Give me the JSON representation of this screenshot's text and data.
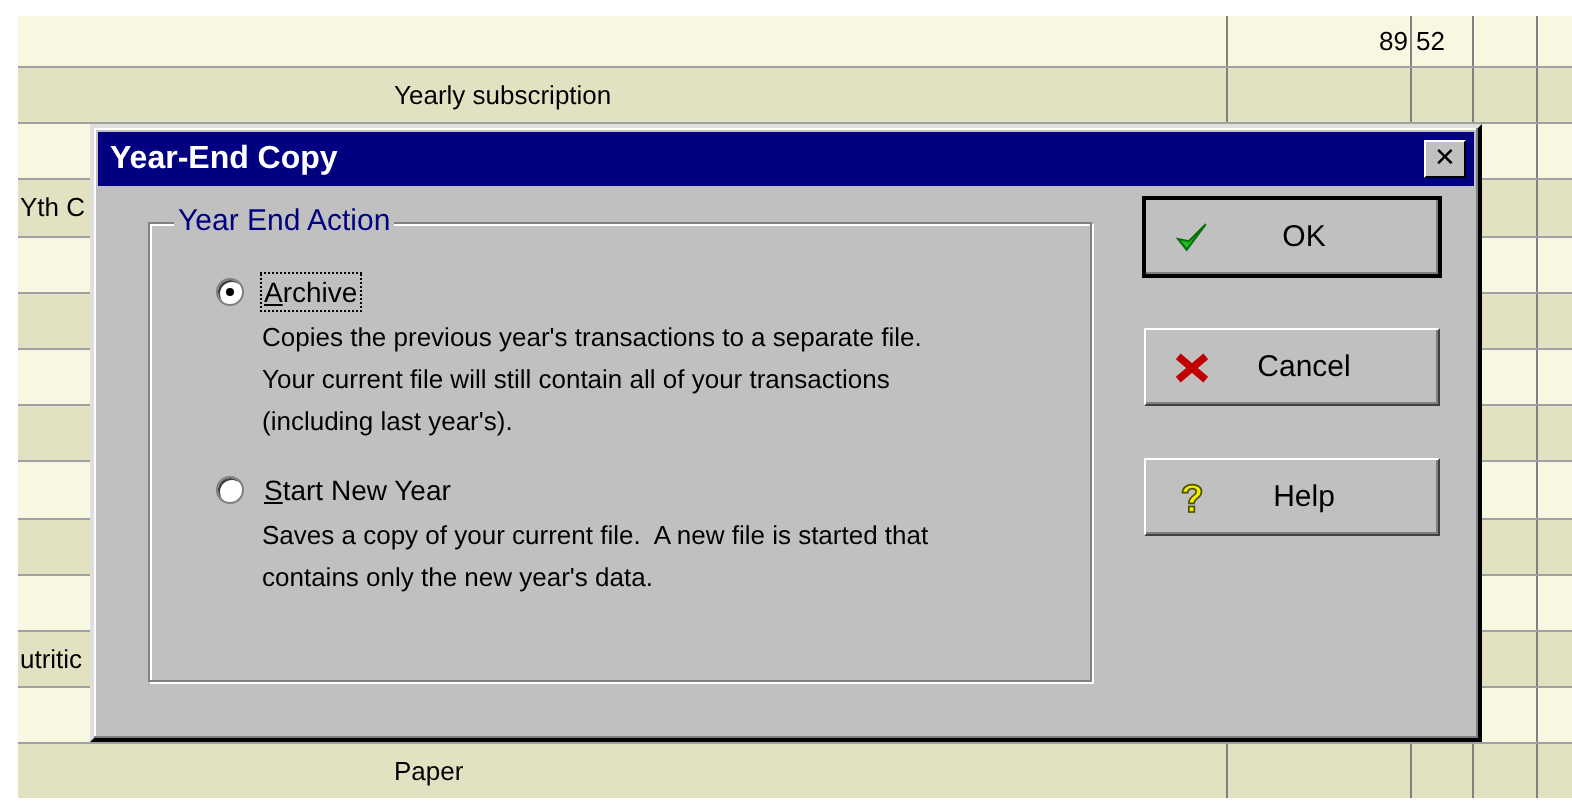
{
  "register": {
    "rows": [
      {
        "payee": "",
        "memo": "",
        "amount": "89",
        "cents": "52"
      },
      {
        "payee": "",
        "memo": "Yearly subscription",
        "amount": "",
        "cents": ""
      },
      {
        "payee": "",
        "memo": "",
        "amount": "",
        "cents": ""
      },
      {
        "payee": "Yth C",
        "memo": "",
        "amount": "",
        "cents": ""
      },
      {
        "payee": "",
        "memo": "",
        "amount": "",
        "cents": ""
      },
      {
        "payee": "",
        "memo": "",
        "amount": "",
        "cents": ""
      },
      {
        "payee": "",
        "memo": "",
        "amount": "",
        "cents": ""
      },
      {
        "payee": "",
        "memo": "",
        "amount": "",
        "cents": ""
      },
      {
        "payee": "",
        "memo": "",
        "amount": "",
        "cents": ""
      },
      {
        "payee": "",
        "memo": "",
        "amount": "",
        "cents": ""
      },
      {
        "payee": "",
        "memo": "",
        "amount": "",
        "cents": ""
      },
      {
        "payee": "utritic",
        "memo": "",
        "amount": "",
        "cents": ""
      },
      {
        "payee": "",
        "memo": "",
        "amount": "",
        "cents": ""
      },
      {
        "payee": "",
        "memo": "Paper",
        "amount": "",
        "cents": ""
      }
    ]
  },
  "dialog": {
    "title": "Year-End Copy",
    "close": "✕",
    "group": {
      "label": "Year End Action",
      "options": [
        {
          "label": "Archive",
          "selected": true,
          "focused": true,
          "description": "Copies the previous year's transactions to a separate file.  Your current file will still contain all of your transactions (including last year's)."
        },
        {
          "label": "Start New Year",
          "selected": false,
          "focused": false,
          "description": "Saves a copy of your current file.  A new file is started that contains only the new year's data."
        }
      ]
    },
    "buttons": [
      {
        "label": "OK",
        "kind": "check",
        "default": true
      },
      {
        "label": "Cancel",
        "kind": "cross",
        "default": false
      },
      {
        "label": "Help",
        "kind": "help",
        "default": false
      }
    ]
  }
}
